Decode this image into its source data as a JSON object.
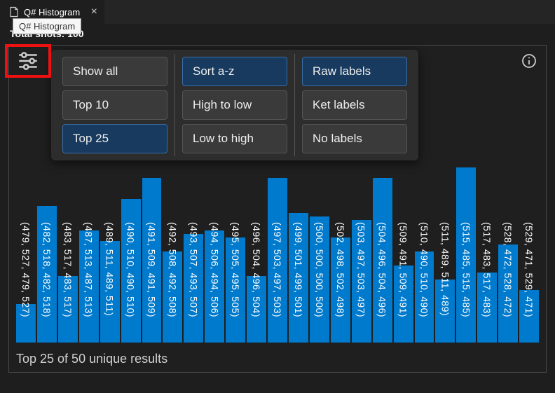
{
  "tab": {
    "title": "Q# Histogram"
  },
  "tooltip": "Q# Histogram",
  "header": "Total shots: 100",
  "info_icon": "info-icon",
  "settings_icon": "settings-icon",
  "options": {
    "filter": [
      {
        "label": "Show all",
        "selected": false
      },
      {
        "label": "Top 10",
        "selected": false
      },
      {
        "label": "Top 25",
        "selected": true
      }
    ],
    "sort": [
      {
        "label": "Sort a-z",
        "selected": true
      },
      {
        "label": "High to low",
        "selected": false
      },
      {
        "label": "Low to high",
        "selected": false
      }
    ],
    "labels": [
      {
        "label": "Raw labels",
        "selected": true
      },
      {
        "label": "Ket labels",
        "selected": false
      },
      {
        "label": "No labels",
        "selected": false
      }
    ]
  },
  "footer": "Top 25 of 50 unique results",
  "chart_data": {
    "type": "bar",
    "title": "Q# Histogram",
    "xlabel": "",
    "ylabel": "",
    "ylim": [
      0,
      100
    ],
    "categories": [
      "(479, 527, 479, 527)",
      "(482, 518, 482, 518)",
      "(483, 517, 483, 517)",
      "(487, 513, 487, 513)",
      "(489, 511, 489, 511)",
      "(490, 510, 490, 510)",
      "(491, 509, 491, 509)",
      "(492, 508, 492, 508)",
      "(493, 507, 493, 507)",
      "(494, 506, 494, 506)",
      "(495, 505, 495, 505)",
      "(496, 504, 496, 504)",
      "(497, 503, 497, 503)",
      "(499, 501, 499, 501)",
      "(500, 500, 500, 500)",
      "(502, 498, 502, 498)",
      "(503, 497, 503, 497)",
      "(504, 496, 504, 496)",
      "(509, 491, 509, 491)",
      "(510, 490, 510, 490)",
      "(511, 489, 511, 489)",
      "(515, 485, 515, 485)",
      "(517, 483, 517, 483)",
      "(528, 472, 528, 472)",
      "(529, 471, 529, 471)"
    ],
    "values": [
      22,
      78,
      38,
      64,
      58,
      82,
      94,
      52,
      62,
      64,
      60,
      38,
      94,
      74,
      72,
      60,
      70,
      94,
      44,
      52,
      36,
      100,
      40,
      56,
      30
    ]
  }
}
